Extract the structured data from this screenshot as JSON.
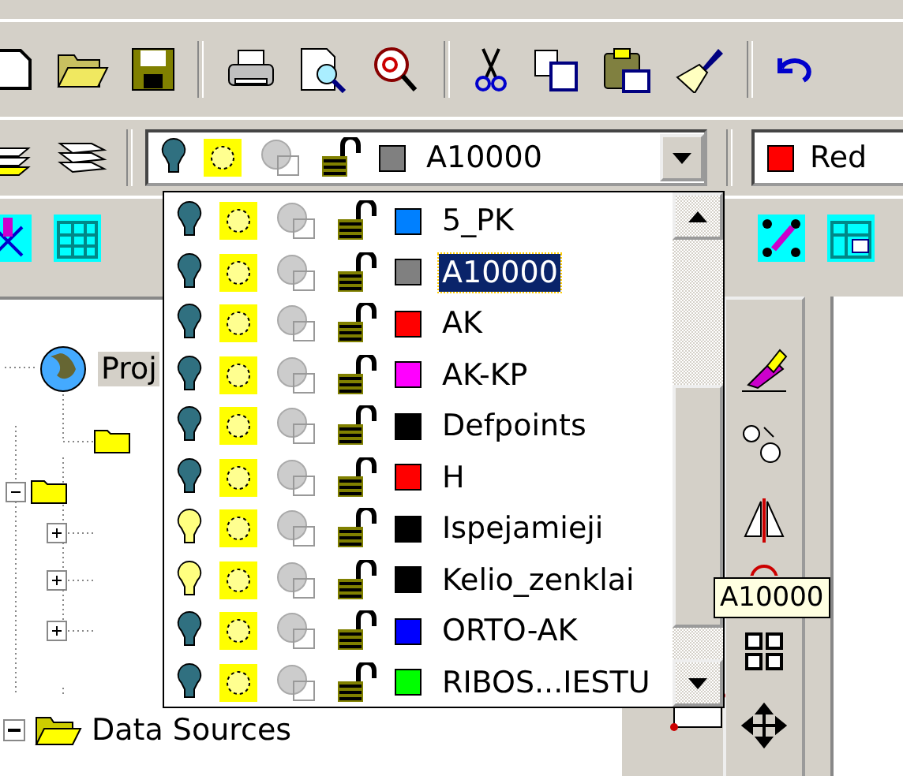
{
  "layer_combo": {
    "name": "A10000",
    "color": "#808080",
    "on": false
  },
  "color_combo": {
    "label": "Red",
    "color": "#ff0000"
  },
  "layer_list": [
    {
      "name": "5_PK",
      "color": "#0080ff",
      "on": false,
      "selected": false
    },
    {
      "name": "A10000",
      "color": "#808080",
      "on": false,
      "selected": true
    },
    {
      "name": "AK",
      "color": "#ff0000",
      "on": false,
      "selected": false
    },
    {
      "name": "AK-KP",
      "color": "#ff00ff",
      "on": false,
      "selected": false
    },
    {
      "name": "Defpoints",
      "color": "#000000",
      "on": false,
      "selected": false
    },
    {
      "name": "H",
      "color": "#ff0000",
      "on": false,
      "selected": false
    },
    {
      "name": "Ispejamieji",
      "color": "#000000",
      "on": true,
      "selected": false
    },
    {
      "name": "Kelio_zenklai",
      "color": "#000000",
      "on": true,
      "selected": false
    },
    {
      "name": "ORTO-AK",
      "color": "#0000ff",
      "on": false,
      "selected": false
    },
    {
      "name": "RIBOS...IESTU",
      "color": "#00ff00",
      "on": false,
      "selected": false
    }
  ],
  "tree": [
    {
      "label": "Proj"
    },
    {
      "label": "Data Sources",
      "expanded": true
    }
  ],
  "tooltip": "A10000"
}
